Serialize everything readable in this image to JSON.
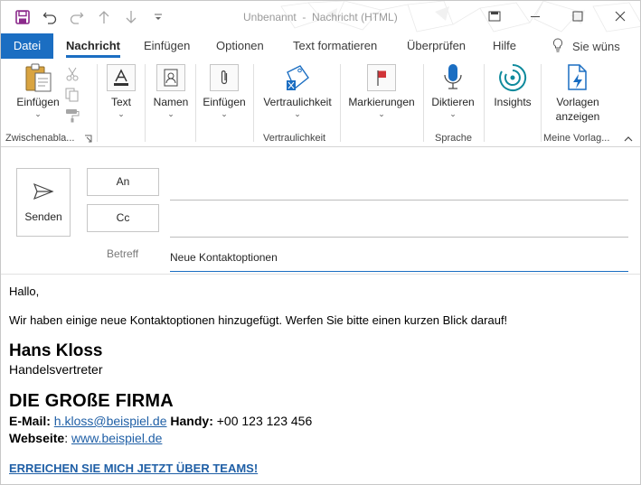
{
  "window": {
    "title": "Unbenannt  -  Nachricht (HTML)"
  },
  "tabs": {
    "file": "Datei",
    "items": [
      "Nachricht",
      "Einfügen",
      "Optionen",
      "Text formatieren",
      "Überprüfen",
      "Hilfe"
    ],
    "active": "Nachricht",
    "tell_me": "Sie wüns"
  },
  "ribbon": {
    "paste": {
      "label": "Einfügen"
    },
    "clipboard_group": "Zwischenabla...",
    "text": {
      "label": "Text"
    },
    "names": {
      "label": "Namen"
    },
    "insert": {
      "label": "Einfügen"
    },
    "sensitivity": {
      "label": "Vertraulichkeit"
    },
    "sensitivity_group": "Vertraulichkeit",
    "tags": {
      "label": "Markierungen"
    },
    "dictate": {
      "label": "Diktieren"
    },
    "speech_group": "Sprache",
    "insights": {
      "label": "Insights"
    },
    "templates": {
      "line1": "Vorlagen",
      "line2": "anzeigen"
    },
    "templates_group": "Meine Vorlag..."
  },
  "compose": {
    "send_label": "Senden",
    "to_label": "An",
    "cc_label": "Cc",
    "subject_label": "Betreff",
    "subject_value": "Neue Kontaktoptionen",
    "to_value": "",
    "cc_value": ""
  },
  "message": {
    "greeting": "Hallo,",
    "text": "Wir haben einige neue Kontaktoptionen hinzugefügt. Werfen Sie bitte einen kurzen Blick darauf!",
    "signature": {
      "name": "Hans Kloss",
      "role": "Handelsvertreter",
      "company": "DIE GROßE FIRMA",
      "email_label": "E-Mail:",
      "email": "h.kloss@beispiel.de",
      "phone_label": "Handy:",
      "phone": "+00 123 123 456",
      "web_label": "Webseite",
      "web_colon": ": ",
      "web": "www.beispiel.de",
      "teams": "ERREICHEN SIE MICH JETZT ÜBER TEAMS!"
    }
  },
  "colors": {
    "accent": "#1b6ec2",
    "link": "#1f5fa6",
    "save_icon": "#8b2a8b",
    "flag_red": "#d13438",
    "insights_teal": "#0e8a9c"
  }
}
